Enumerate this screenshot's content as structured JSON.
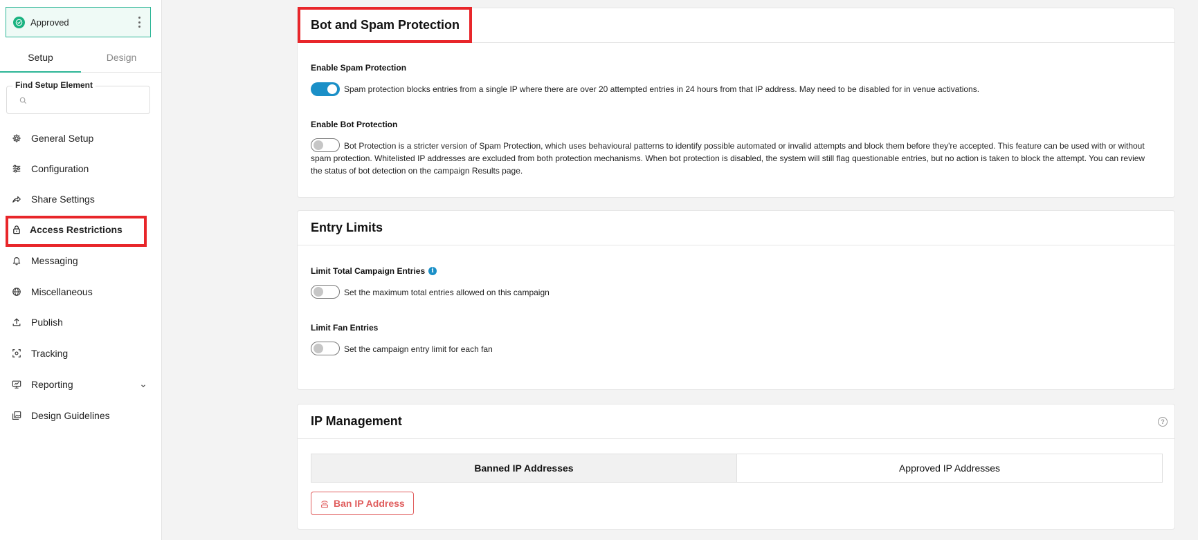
{
  "status": {
    "label": "Approved"
  },
  "tabs": [
    {
      "label": "Setup"
    },
    {
      "label": "Design"
    }
  ],
  "search": {
    "label": "Find Setup Element",
    "placeholder": ""
  },
  "nav": [
    {
      "label": "General Setup",
      "icon": "gear-icon"
    },
    {
      "label": "Configuration",
      "icon": "sliders-icon"
    },
    {
      "label": "Share Settings",
      "icon": "share-icon"
    },
    {
      "label": "Access Restrictions",
      "icon": "lock-icon",
      "active": true
    },
    {
      "label": "Messaging",
      "icon": "bell-icon"
    },
    {
      "label": "Miscellaneous",
      "icon": "globe-icon"
    },
    {
      "label": "Publish",
      "icon": "upload-icon"
    },
    {
      "label": "Tracking",
      "icon": "tracking-icon"
    },
    {
      "label": "Reporting",
      "icon": "monitor-icon"
    },
    {
      "label": "Design Guidelines",
      "icon": "images-icon"
    }
  ],
  "bot_spam": {
    "title": "Bot and Spam Protection",
    "spam_label": "Enable Spam Protection",
    "spam_enabled": true,
    "spam_desc": "Spam protection blocks entries from a single IP where there are over 20 attempted entries in 24 hours from that IP address. May need to be disabled for in venue activations.",
    "bot_label": "Enable Bot Protection",
    "bot_enabled": false,
    "bot_desc": "Bot Protection is a stricter version of Spam Protection, which uses behavioural patterns to identify possible automated or invalid attempts and block them before they're accepted. This feature can be used with or without spam protection. Whitelisted IP addresses are excluded from both protection mechanisms. When bot protection is disabled, the system will still flag questionable entries, but no action is taken to block the attempt. You can review the status of bot detection on the campaign Results page."
  },
  "entry_limits": {
    "title": "Entry Limits",
    "total_label": "Limit Total Campaign Entries",
    "total_enabled": false,
    "total_desc": "Set the maximum total entries allowed on this campaign",
    "fan_label": "Limit Fan Entries",
    "fan_enabled": false,
    "fan_desc": "Set the campaign entry limit for each fan"
  },
  "ip_management": {
    "title": "IP Management",
    "tab_banned": "Banned IP Addresses",
    "tab_approved": "Approved IP Addresses",
    "ban_button": "Ban IP Address"
  },
  "colors": {
    "accent": "#1a8fc7",
    "success": "#1ab381",
    "danger": "#e05d5d",
    "highlight": "#e8262a"
  }
}
